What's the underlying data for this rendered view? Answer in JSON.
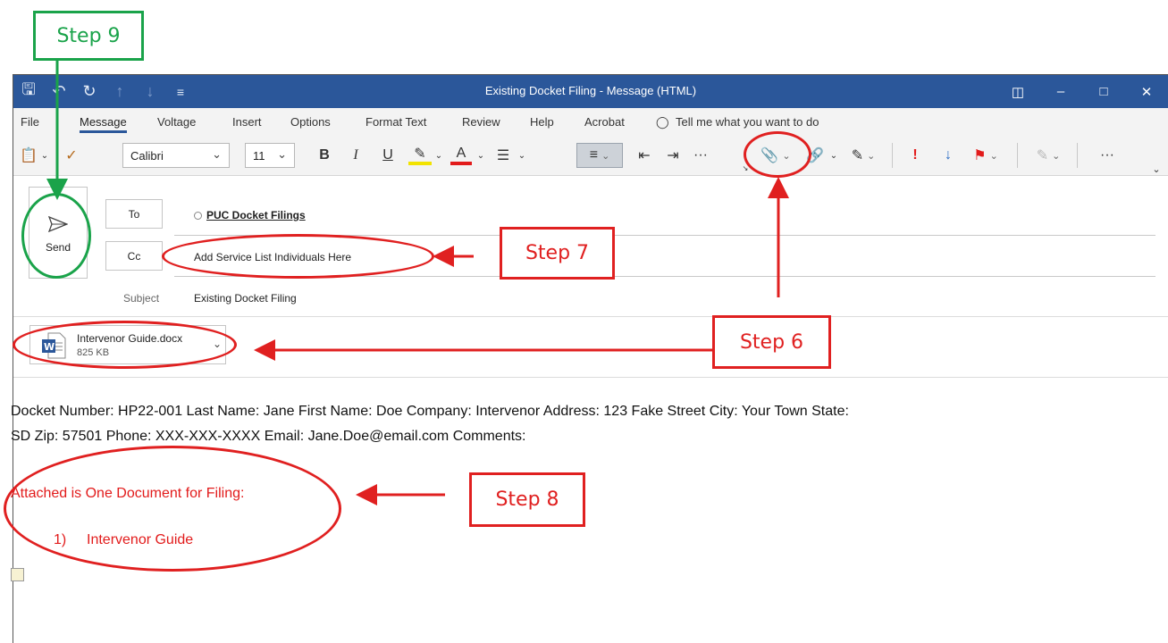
{
  "window": {
    "title": "Existing Docket Filing  -  Message (HTML)",
    "qat_icons": [
      "save-icon",
      "undo-icon",
      "redo-icon",
      "up-arrow-icon",
      "down-arrow-icon",
      "customize-icon"
    ],
    "controls": [
      "restore-ribbon-icon",
      "minimize-icon",
      "maximize-icon",
      "close-icon"
    ]
  },
  "menu": {
    "tabs": [
      "File",
      "Message",
      "Voltage",
      "Insert",
      "Options",
      "Format Text",
      "Review",
      "Help",
      "Acrobat"
    ],
    "active": "Message",
    "tell_me": "Tell me what you want to do"
  },
  "ribbon": {
    "font": "Calibri",
    "size": "11",
    "bold": "B",
    "italic": "I",
    "underline": "U",
    "font_color": "A",
    "more": "···"
  },
  "header": {
    "send_label": "Send",
    "to_label": "To",
    "cc_label": "Cc",
    "to_value": "PUC Docket Filings",
    "cc_value": "Add Service List Individuals Here",
    "subject_label": "Subject",
    "subject_value": "Existing Docket Filing"
  },
  "attachment": {
    "name": "Intervenor Guide.docx",
    "size": "825 KB"
  },
  "body": {
    "line1": "Docket Number: HP22-001 Last Name: Jane  First Name: Doe   Company: Intervenor   Address: 123 Fake Street   City: Your Town   State:",
    "line2": "SD  Zip: 57501   Phone: XXX-XXX-XXXX    Email: Jane.Doe@email.com   Comments:",
    "attached_heading": "Attached is One Document for Filing:",
    "list_number": "1)",
    "list_item": "Intervenor Guide"
  },
  "annotations": {
    "step6": "Step 6",
    "step7": "Step 7",
    "step8": "Step 8",
    "step9": "Step 9",
    "red": "#e02020",
    "green": "#1aa34a"
  },
  "colors": {
    "titlebar": "#2b579a",
    "ribbon": "#f3f3f3"
  }
}
